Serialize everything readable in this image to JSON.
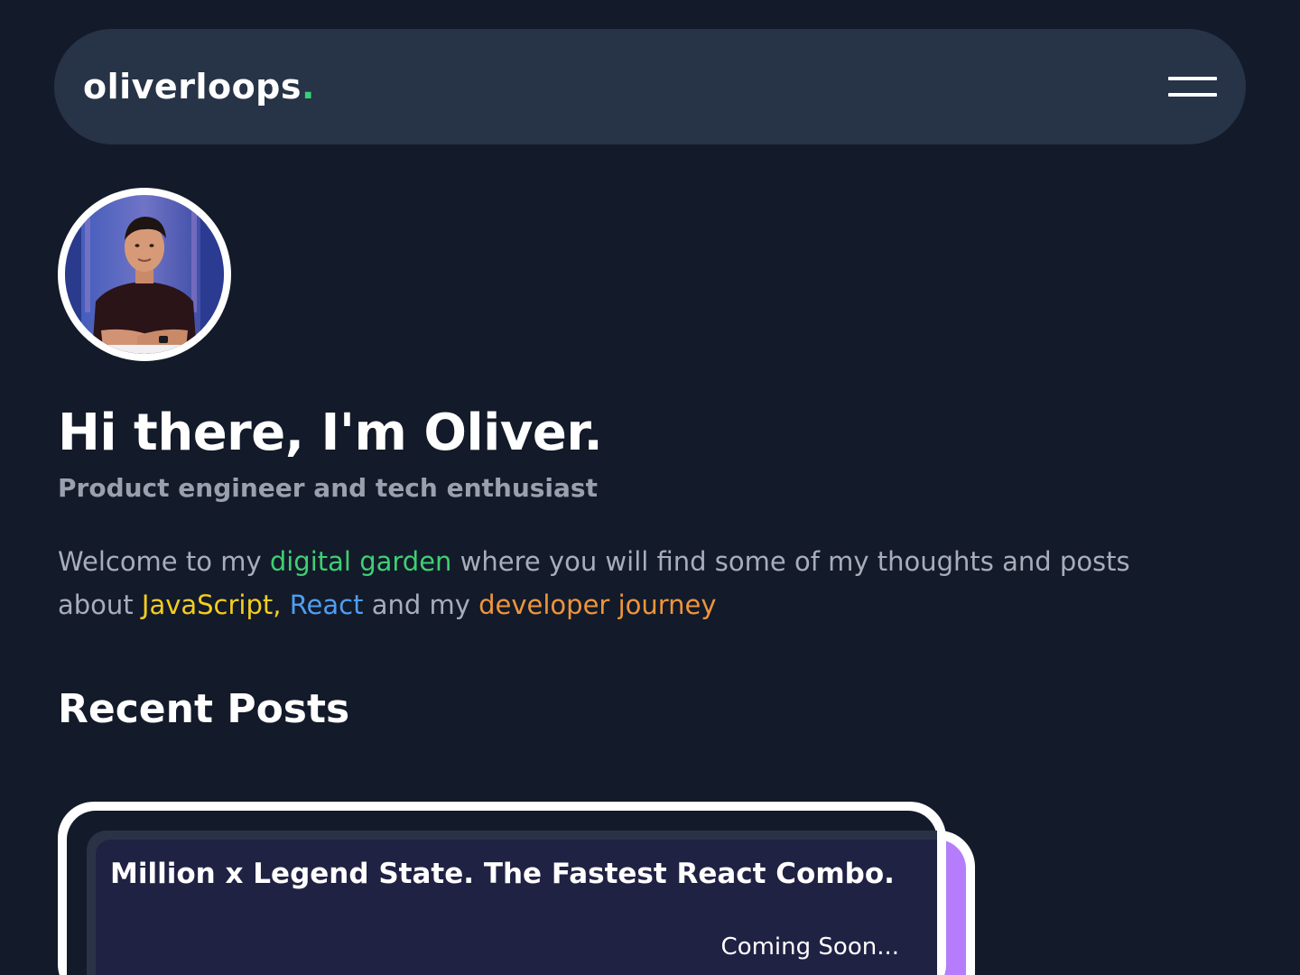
{
  "header": {
    "logo_text": "oliverloops",
    "logo_dot": ".",
    "menu_icon": "hamburger-menu-icon"
  },
  "hero": {
    "title": "Hi there, I'm Oliver.",
    "subtitle": "Product engineer and tech enthusiast",
    "intro": {
      "part1": "Welcome to my ",
      "link_garden": "digital garden",
      "part2": " where you will find some of my thoughts and posts about ",
      "link_js": "JavaScript,",
      "part3": " ",
      "link_react": "React",
      "part4": " and my ",
      "link_journey": "developer journey"
    }
  },
  "recent_posts": {
    "title": "Recent Posts",
    "posts": [
      {
        "title": "Million x Legend State. The Fastest React Combo.",
        "status": "Coming Soon..."
      }
    ]
  },
  "colors": {
    "background": "#131a2a",
    "navbar": "#273346",
    "accent_green": "#3fcf72",
    "accent_yellow": "#f4cd1f",
    "accent_blue": "#4f9ef1",
    "accent_orange": "#ee953b",
    "card_purple": "#b57dfb"
  }
}
